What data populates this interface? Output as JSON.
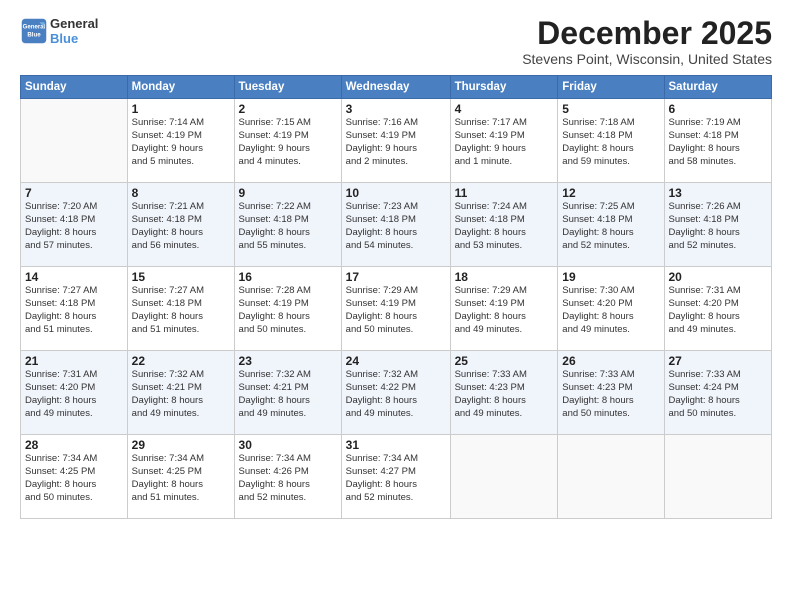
{
  "header": {
    "logo_line1": "General",
    "logo_line2": "Blue",
    "month": "December 2025",
    "location": "Stevens Point, Wisconsin, United States"
  },
  "weekdays": [
    "Sunday",
    "Monday",
    "Tuesday",
    "Wednesday",
    "Thursday",
    "Friday",
    "Saturday"
  ],
  "weeks": [
    [
      {
        "day": "",
        "info": ""
      },
      {
        "day": "1",
        "info": "Sunrise: 7:14 AM\nSunset: 4:19 PM\nDaylight: 9 hours\nand 5 minutes."
      },
      {
        "day": "2",
        "info": "Sunrise: 7:15 AM\nSunset: 4:19 PM\nDaylight: 9 hours\nand 4 minutes."
      },
      {
        "day": "3",
        "info": "Sunrise: 7:16 AM\nSunset: 4:19 PM\nDaylight: 9 hours\nand 2 minutes."
      },
      {
        "day": "4",
        "info": "Sunrise: 7:17 AM\nSunset: 4:19 PM\nDaylight: 9 hours\nand 1 minute."
      },
      {
        "day": "5",
        "info": "Sunrise: 7:18 AM\nSunset: 4:18 PM\nDaylight: 8 hours\nand 59 minutes."
      },
      {
        "day": "6",
        "info": "Sunrise: 7:19 AM\nSunset: 4:18 PM\nDaylight: 8 hours\nand 58 minutes."
      }
    ],
    [
      {
        "day": "7",
        "info": "Sunrise: 7:20 AM\nSunset: 4:18 PM\nDaylight: 8 hours\nand 57 minutes."
      },
      {
        "day": "8",
        "info": "Sunrise: 7:21 AM\nSunset: 4:18 PM\nDaylight: 8 hours\nand 56 minutes."
      },
      {
        "day": "9",
        "info": "Sunrise: 7:22 AM\nSunset: 4:18 PM\nDaylight: 8 hours\nand 55 minutes."
      },
      {
        "day": "10",
        "info": "Sunrise: 7:23 AM\nSunset: 4:18 PM\nDaylight: 8 hours\nand 54 minutes."
      },
      {
        "day": "11",
        "info": "Sunrise: 7:24 AM\nSunset: 4:18 PM\nDaylight: 8 hours\nand 53 minutes."
      },
      {
        "day": "12",
        "info": "Sunrise: 7:25 AM\nSunset: 4:18 PM\nDaylight: 8 hours\nand 52 minutes."
      },
      {
        "day": "13",
        "info": "Sunrise: 7:26 AM\nSunset: 4:18 PM\nDaylight: 8 hours\nand 52 minutes."
      }
    ],
    [
      {
        "day": "14",
        "info": "Sunrise: 7:27 AM\nSunset: 4:18 PM\nDaylight: 8 hours\nand 51 minutes."
      },
      {
        "day": "15",
        "info": "Sunrise: 7:27 AM\nSunset: 4:18 PM\nDaylight: 8 hours\nand 51 minutes."
      },
      {
        "day": "16",
        "info": "Sunrise: 7:28 AM\nSunset: 4:19 PM\nDaylight: 8 hours\nand 50 minutes."
      },
      {
        "day": "17",
        "info": "Sunrise: 7:29 AM\nSunset: 4:19 PM\nDaylight: 8 hours\nand 50 minutes."
      },
      {
        "day": "18",
        "info": "Sunrise: 7:29 AM\nSunset: 4:19 PM\nDaylight: 8 hours\nand 49 minutes."
      },
      {
        "day": "19",
        "info": "Sunrise: 7:30 AM\nSunset: 4:20 PM\nDaylight: 8 hours\nand 49 minutes."
      },
      {
        "day": "20",
        "info": "Sunrise: 7:31 AM\nSunset: 4:20 PM\nDaylight: 8 hours\nand 49 minutes."
      }
    ],
    [
      {
        "day": "21",
        "info": "Sunrise: 7:31 AM\nSunset: 4:20 PM\nDaylight: 8 hours\nand 49 minutes."
      },
      {
        "day": "22",
        "info": "Sunrise: 7:32 AM\nSunset: 4:21 PM\nDaylight: 8 hours\nand 49 minutes."
      },
      {
        "day": "23",
        "info": "Sunrise: 7:32 AM\nSunset: 4:21 PM\nDaylight: 8 hours\nand 49 minutes."
      },
      {
        "day": "24",
        "info": "Sunrise: 7:32 AM\nSunset: 4:22 PM\nDaylight: 8 hours\nand 49 minutes."
      },
      {
        "day": "25",
        "info": "Sunrise: 7:33 AM\nSunset: 4:23 PM\nDaylight: 8 hours\nand 49 minutes."
      },
      {
        "day": "26",
        "info": "Sunrise: 7:33 AM\nSunset: 4:23 PM\nDaylight: 8 hours\nand 50 minutes."
      },
      {
        "day": "27",
        "info": "Sunrise: 7:33 AM\nSunset: 4:24 PM\nDaylight: 8 hours\nand 50 minutes."
      }
    ],
    [
      {
        "day": "28",
        "info": "Sunrise: 7:34 AM\nSunset: 4:25 PM\nDaylight: 8 hours\nand 50 minutes."
      },
      {
        "day": "29",
        "info": "Sunrise: 7:34 AM\nSunset: 4:25 PM\nDaylight: 8 hours\nand 51 minutes."
      },
      {
        "day": "30",
        "info": "Sunrise: 7:34 AM\nSunset: 4:26 PM\nDaylight: 8 hours\nand 52 minutes."
      },
      {
        "day": "31",
        "info": "Sunrise: 7:34 AM\nSunset: 4:27 PM\nDaylight: 8 hours\nand 52 minutes."
      },
      {
        "day": "",
        "info": ""
      },
      {
        "day": "",
        "info": ""
      },
      {
        "day": "",
        "info": ""
      }
    ]
  ]
}
